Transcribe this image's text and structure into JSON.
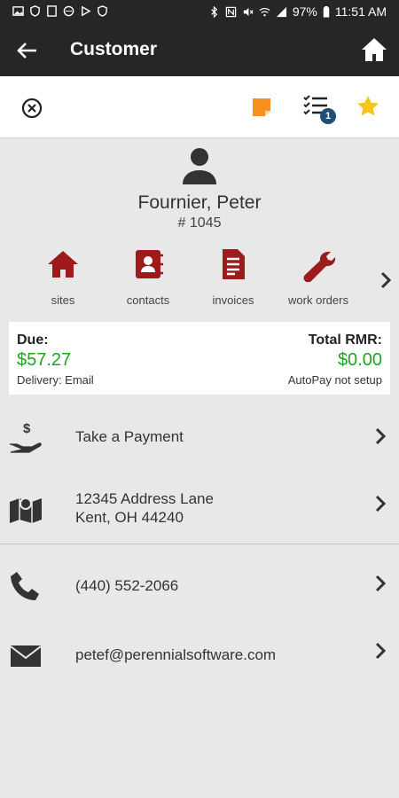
{
  "status_bar": {
    "battery": "97%",
    "time": "11:51 AM"
  },
  "app_bar": {
    "title": "Customer"
  },
  "toolbar": {
    "list_badge": "1"
  },
  "customer": {
    "name": "Fournier, Peter",
    "number": "# 1045"
  },
  "quick_actions": [
    {
      "label": "sites",
      "icon": "home-icon"
    },
    {
      "label": "contacts",
      "icon": "contact-book-icon"
    },
    {
      "label": "invoices",
      "icon": "invoice-icon"
    },
    {
      "label": "work orders",
      "icon": "wrench-icon"
    }
  ],
  "billing": {
    "due_label": "Due:",
    "due_value": "$57.27",
    "delivery": "Delivery: Email",
    "rmr_label": "Total RMR:",
    "rmr_value": "$0.00",
    "autopay": "AutoPay not setup"
  },
  "rows": {
    "payment": "Take a Payment",
    "address_line1": "12345 Address Lane",
    "address_line2": "Kent, OH 44240",
    "phone": "(440) 552-2066",
    "email": "petef@perennialsoftware.com"
  },
  "colors": {
    "bar": "#262626",
    "accent_red": "#9e1b1b",
    "money_green": "#1ea51e",
    "note_orange": "#f7901e",
    "star_yellow": "#f5c518",
    "badge_blue": "#1f4e79"
  }
}
